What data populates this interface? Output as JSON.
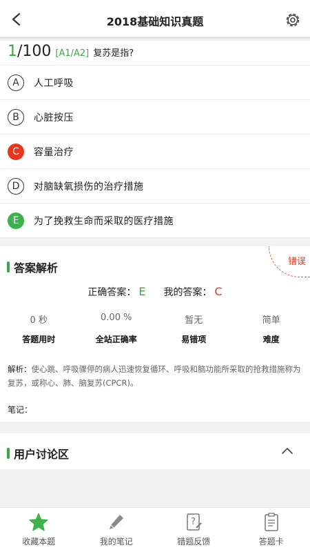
{
  "header": {
    "title": "2018基础知识真题",
    "back_icon": "back-arrow-icon",
    "settings_icon": "gear-icon"
  },
  "question": {
    "current": "1",
    "total": "/100",
    "type": "[A1/A2]",
    "text": "复苏是指?"
  },
  "options": [
    {
      "letter": "A",
      "text": "人工呼吸",
      "state": "normal"
    },
    {
      "letter": "B",
      "text": "心脏按压",
      "state": "normal"
    },
    {
      "letter": "C",
      "text": "容量治疗",
      "state": "wrong"
    },
    {
      "letter": "D",
      "text": "对脑缺氧损伤的治疗措施",
      "state": "normal"
    },
    {
      "letter": "E",
      "text": "为了挽救生命而采取的医疗措施",
      "state": "correct"
    }
  ],
  "analysis": {
    "title": "答案解析",
    "result_stamp": "错误",
    "correct_label": "正确答案：",
    "correct_value": "E",
    "mine_label": "我的答案：",
    "mine_value": "C",
    "stats": [
      {
        "value": "0 秒",
        "label": "答题用时"
      },
      {
        "value": "0.00 %",
        "label": "全站正确率"
      },
      {
        "value": "暂无",
        "label": "易错项"
      },
      {
        "value": "简单",
        "label": "难度"
      }
    ],
    "explain_label": "解析：",
    "explain_text": "使心跳、呼吸骤停的病人迅速恢复循环、呼吸和脑功能所采取的抢救措施称为复苏，或称心、肺、脑复苏(CPCR)。",
    "notes_label": "笔记："
  },
  "discussion": {
    "title": "用户讨论区"
  },
  "tabbar": [
    {
      "label": "收藏本题",
      "icon": "star-icon"
    },
    {
      "label": "我的笔记",
      "icon": "pencil-icon"
    },
    {
      "label": "错题反馈",
      "icon": "question-doc-icon"
    },
    {
      "label": "答题卡",
      "icon": "clipboard-icon"
    }
  ],
  "colors": {
    "accent": "#3aa745",
    "wrong": "#e8361e",
    "correct_badge": "#3bb34a"
  }
}
